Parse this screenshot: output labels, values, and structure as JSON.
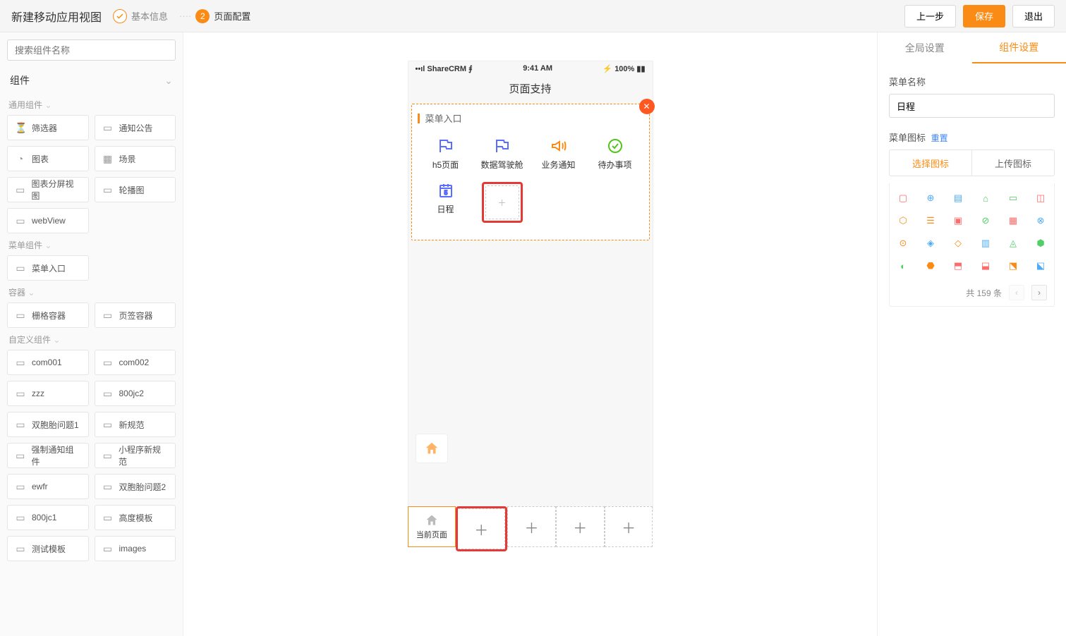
{
  "header": {
    "title": "新建移动应用视图",
    "step1": "基本信息",
    "step2": "页面配置",
    "step2_num": "2",
    "prev": "上一步",
    "save": "保存",
    "exit": "退出"
  },
  "left": {
    "search_placeholder": "搜索组件名称",
    "accordion": "组件",
    "groups": [
      {
        "label": "通用组件",
        "items": [
          "筛选器",
          "通知公告",
          "图表",
          "场景",
          "图表分屏视图",
          "轮播图",
          "webView"
        ]
      },
      {
        "label": "菜单组件",
        "items": [
          "菜单入口"
        ]
      },
      {
        "label": "容器",
        "items": [
          "栅格容器",
          "页签容器"
        ]
      },
      {
        "label": "自定义组件",
        "items": [
          "com001",
          "com002",
          "zzz",
          "800jc2",
          "双胞胎问题1",
          "新规范",
          "强制通知组件",
          "小程序新规范",
          "ewfr",
          "双胞胎问题2",
          "800jc1",
          "高度模板",
          "测试模板",
          "images"
        ]
      }
    ]
  },
  "canvas": {
    "status_carrier": "ShareCRM",
    "status_time": "9:41 AM",
    "status_batt": "100%",
    "page_title": "页面支持",
    "menu_title": "菜单入口",
    "menu_items": [
      {
        "label": "h5页面",
        "color": "#5b6dff",
        "type": "flag"
      },
      {
        "label": "数据驾驶舱",
        "color": "#5b6dff",
        "type": "flag"
      },
      {
        "label": "业务通知",
        "color": "#fa8c16",
        "type": "horn"
      },
      {
        "label": "待办事项",
        "color": "#52c41a",
        "type": "check"
      },
      {
        "label": "日程",
        "color": "#5b6dff",
        "type": "cal"
      }
    ],
    "current_page": "当前页面"
  },
  "right": {
    "tab_global": "全局设置",
    "tab_comp": "组件设置",
    "menu_name_label": "菜单名称",
    "menu_name_value": "日程",
    "menu_icon_label": "菜单图标",
    "reset": "重置",
    "select_icon": "选择图标",
    "upload_icon": "上传图标",
    "total": "共 159 条",
    "palette": [
      [
        "#ff6b6b",
        "#4dabf7",
        "#4dabf7",
        "#51cf66",
        "#51cf66",
        "#ff6b6b"
      ],
      [
        "#fa8c16",
        "#fa8c16",
        "#ff6b6b",
        "#51cf66",
        "#ff6b6b",
        "#4dabf7"
      ],
      [
        "#fa8c16",
        "#4dabf7",
        "#fa8c16",
        "#4dabf7",
        "#51cf66",
        "#51cf66"
      ],
      [
        "#51cf66",
        "#fa8c16",
        "#ff6b6b",
        "#ff6b6b",
        "#fa8c16",
        "#4dabf7"
      ]
    ]
  }
}
